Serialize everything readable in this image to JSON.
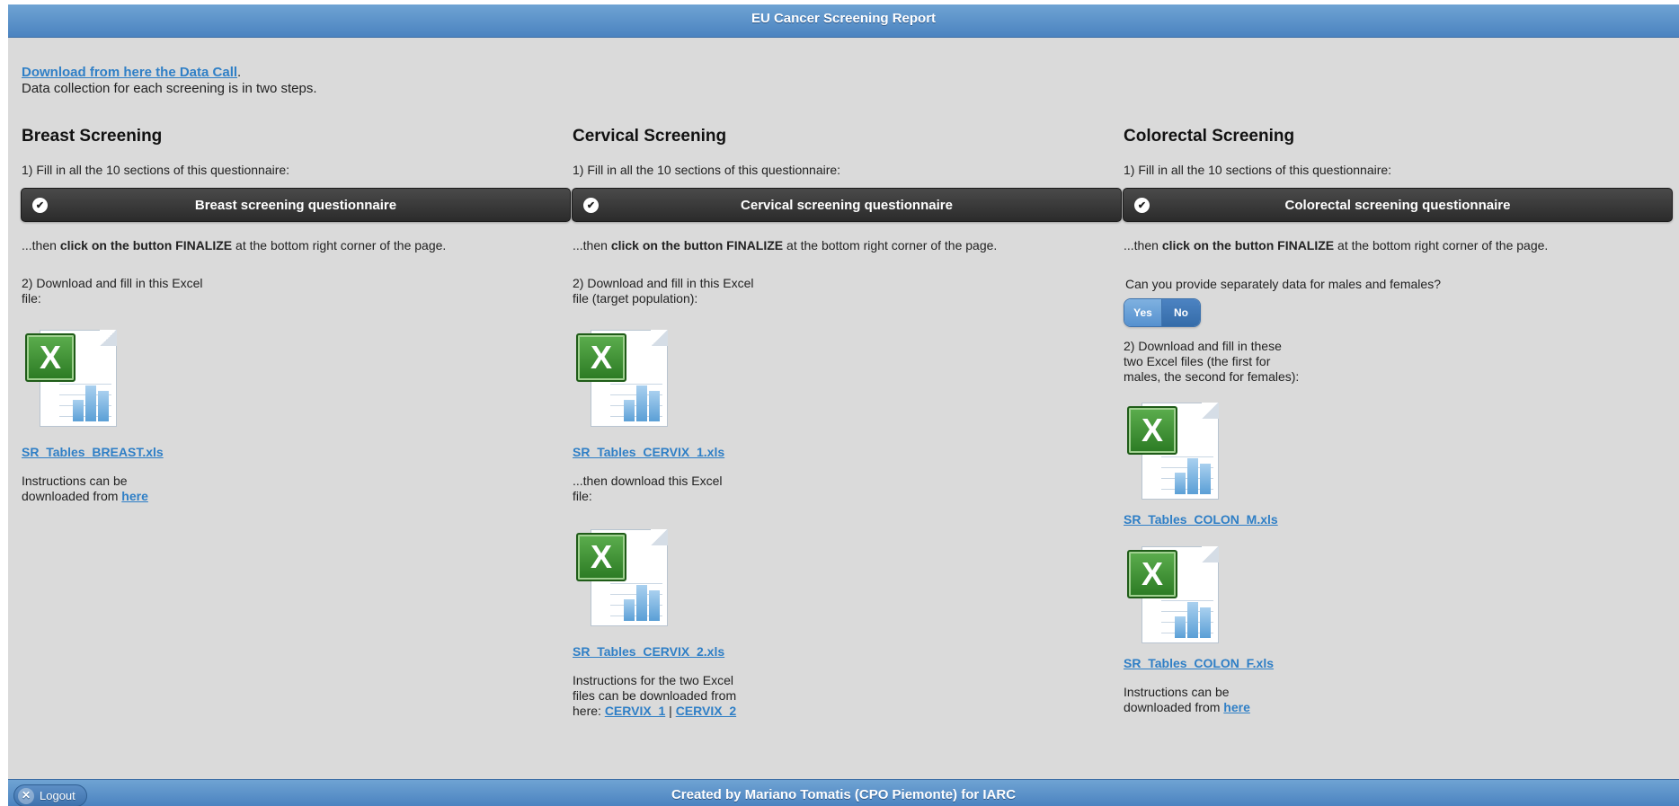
{
  "header": {
    "title": "EU Cancer Screening Report"
  },
  "intro": {
    "download_link": "Download from here the Data Call",
    "period": ".",
    "description": "Data collection for each screening is in two steps."
  },
  "columns": [
    {
      "title": "Breast Screening",
      "step1": "1) Fill in all the 10 sections of this questionnaire:",
      "questionnaire_button": "Breast screening questionnaire",
      "finalize_pre": "...then ",
      "finalize_bold": "click on the button FINALIZE",
      "finalize_post": " at the bottom right corner of the page.",
      "step2": "2) Download and fill in this Excel file:",
      "file1": "SR_Tables_BREAST.xls",
      "instructions_text": "Instructions can be downloaded from ",
      "instructions_link": "here"
    },
    {
      "title": "Cervical Screening",
      "step1": "1) Fill in all the 10 sections of this questionnaire:",
      "questionnaire_button": "Cervical screening questionnaire",
      "finalize_pre": "...then ",
      "finalize_bold": "click on the button FINALIZE",
      "finalize_post": " at the bottom right corner of the page.",
      "step2": "2) Download and fill in this Excel file (target population):",
      "file1": "SR_Tables_CERVIX_1.xls",
      "then_text": "...then download this Excel file:",
      "file2": "SR_Tables_CERVIX_2.xls",
      "instructions_text": "Instructions for the two Excel files can be downloaded from here: ",
      "instructions_link1": "CERVIX_1",
      "separator": " | ",
      "instructions_link2": "CERVIX_2"
    },
    {
      "title": "Colorectal Screening",
      "step1": "1) Fill in all the 10 sections of this questionnaire:",
      "questionnaire_button": "Colorectal screening questionnaire",
      "finalize_pre": "...then ",
      "finalize_bold": "click on the button FINALIZE",
      "finalize_post": " at the bottom right corner of the page.",
      "question": "Can you provide separately data for males and females?",
      "yes_label": "Yes",
      "no_label": "No",
      "step2": "2) Download and fill in these two Excel files (the first for males, the second for females):",
      "file1": "SR_Tables_COLON_M.xls",
      "file2": "SR_Tables_COLON_F.xls",
      "instructions_text": "Instructions can be downloaded from ",
      "instructions_link": "here"
    }
  ],
  "icons": {
    "checkmark": "check-icon",
    "excel": "excel-file-icon",
    "logout": "close-circle-icon"
  },
  "footer": {
    "credit": "Created by Mariano Tomatis (CPO Piemonte) for IARC",
    "logout_label": "Logout"
  },
  "colors": {
    "header_blue": "#5b93cb",
    "link_blue": "#2f7fc6",
    "button_dark": "#333333",
    "excel_green": "#3a8e2f"
  }
}
